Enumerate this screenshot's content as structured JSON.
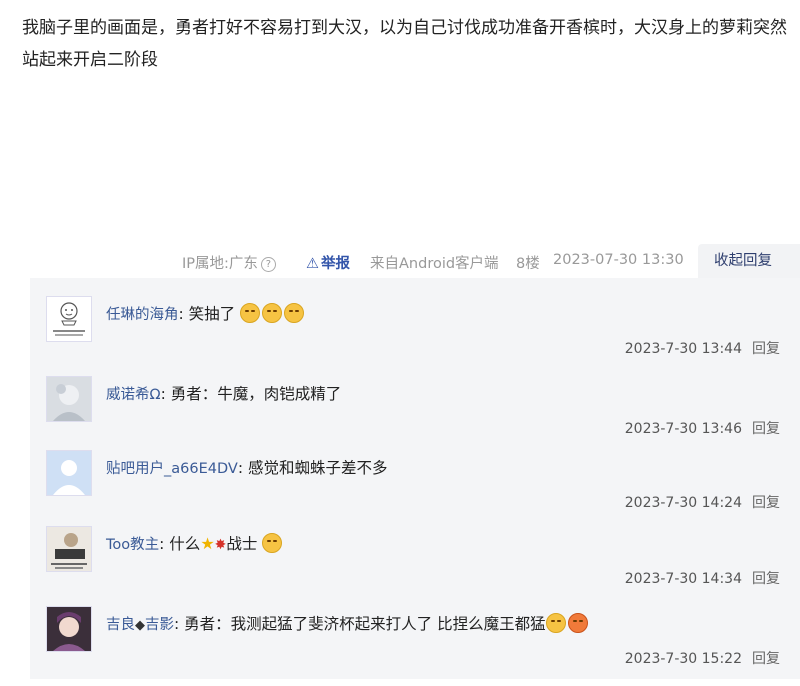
{
  "post": {
    "body": "我脑子里的画面是，勇者打好不容易打到大汉，以为自己讨伐成功准备开香槟时，大汉身上的萝莉突然站起来开启二阶段"
  },
  "meta": {
    "ip": "IP属地:广东",
    "help_icon": "?",
    "report_icon": "⚠",
    "report": "举报",
    "source": "来自Android客户端",
    "floor": "8楼",
    "date": "2023-07-30 13:30",
    "collapse": "收起回复"
  },
  "comments": [
    {
      "user": "任琳的海角",
      "text": "笑抽了",
      "time": "2023-7-30 13:44",
      "reply": "回复",
      "avatar_text": "我是一个很丑的表情"
    },
    {
      "user": "威诺希Ω",
      "text": "勇者：牛魔，肉铠成精了",
      "time": "2023-7-30 13:46",
      "reply": "回复"
    },
    {
      "user": "贴吧用户_a66E4DV",
      "text": "感觉和蜘蛛子差不多",
      "time": "2023-7-30 14:24",
      "reply": "回复"
    },
    {
      "user": "Too教主",
      "text_a": "什么",
      "text_b": "战士",
      "time": "2023-7-30 14:34",
      "reply": "回复"
    },
    {
      "user_a": "吉良",
      "user_b": "吉影",
      "text": "勇者：我测起猛了斐济杯起来打人了 比捏么魔王都猛",
      "time": "2023-7-30 15:22",
      "reply": "回复"
    }
  ]
}
